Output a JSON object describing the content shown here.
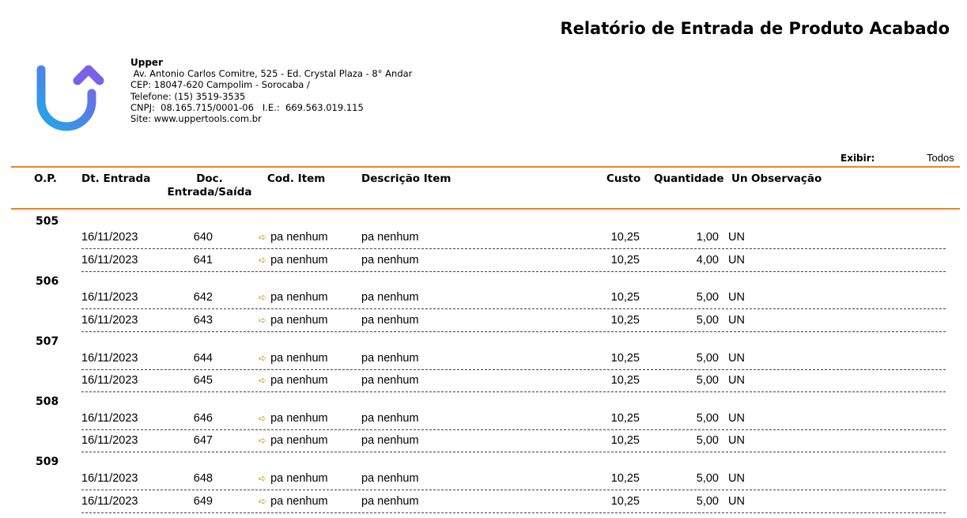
{
  "report_title": "Relatório de Entrada de Produto Acabado",
  "company": {
    "name": "Upper",
    "lines": [
      " Av. Antonio Carlos Comitre, 525 - Ed. Crystal Plaza - 8° Andar",
      "CEP: 18047-620 Campolim - Sorocaba /",
      "Telefone: (15) 3519-3535",
      "CNPJ:  08.165.715/0001-06   I.E.:  669.563.019.115",
      "Site: www.uppertools.com.br"
    ]
  },
  "filter": {
    "label": "Exibir:",
    "value": "Todos"
  },
  "columns": {
    "op": "O.P.",
    "dt": "Dt. Entrada",
    "doc": "Doc.\nEntrada/Saída",
    "cod": "Cod. Item",
    "desc": "Descrição Item",
    "custo": "Custo",
    "qtd": "Quantidade",
    "un": "Un",
    "obs": "Observação"
  },
  "colors": {
    "accent_rule": "#f0821e",
    "logo_blue": "#29a3e6",
    "logo_purple": "#7a6be8"
  },
  "groups": [
    {
      "op": "505",
      "rows": [
        {
          "dt": "16/11/2023",
          "doc": "640",
          "cod": "pa nenhum",
          "desc": "pa nenhum",
          "custo": "10,25",
          "qtd": "1,00",
          "un": "UN"
        },
        {
          "dt": "16/11/2023",
          "doc": "641",
          "cod": "pa nenhum",
          "desc": "pa nenhum",
          "custo": "10,25",
          "qtd": "4,00",
          "un": "UN"
        }
      ]
    },
    {
      "op": "506",
      "rows": [
        {
          "dt": "16/11/2023",
          "doc": "642",
          "cod": "pa nenhum",
          "desc": "pa nenhum",
          "custo": "10,25",
          "qtd": "5,00",
          "un": "UN"
        },
        {
          "dt": "16/11/2023",
          "doc": "643",
          "cod": "pa nenhum",
          "desc": "pa nenhum",
          "custo": "10,25",
          "qtd": "5,00",
          "un": "UN"
        }
      ]
    },
    {
      "op": "507",
      "rows": [
        {
          "dt": "16/11/2023",
          "doc": "644",
          "cod": "pa nenhum",
          "desc": "pa nenhum",
          "custo": "10,25",
          "qtd": "5,00",
          "un": "UN"
        },
        {
          "dt": "16/11/2023",
          "doc": "645",
          "cod": "pa nenhum",
          "desc": "pa nenhum",
          "custo": "10,25",
          "qtd": "5,00",
          "un": "UN"
        }
      ]
    },
    {
      "op": "508",
      "rows": [
        {
          "dt": "16/11/2023",
          "doc": "646",
          "cod": "pa nenhum",
          "desc": "pa nenhum",
          "custo": "10,25",
          "qtd": "5,00",
          "un": "UN"
        },
        {
          "dt": "16/11/2023",
          "doc": "647",
          "cod": "pa nenhum",
          "desc": "pa nenhum",
          "custo": "10,25",
          "qtd": "5,00",
          "un": "UN"
        }
      ]
    },
    {
      "op": "509",
      "rows": [
        {
          "dt": "16/11/2023",
          "doc": "648",
          "cod": "pa nenhum",
          "desc": "pa nenhum",
          "custo": "10,25",
          "qtd": "5,00",
          "un": "UN"
        },
        {
          "dt": "16/11/2023",
          "doc": "649",
          "cod": "pa nenhum",
          "desc": "pa nenhum",
          "custo": "10,25",
          "qtd": "5,00",
          "un": "UN"
        }
      ]
    }
  ]
}
